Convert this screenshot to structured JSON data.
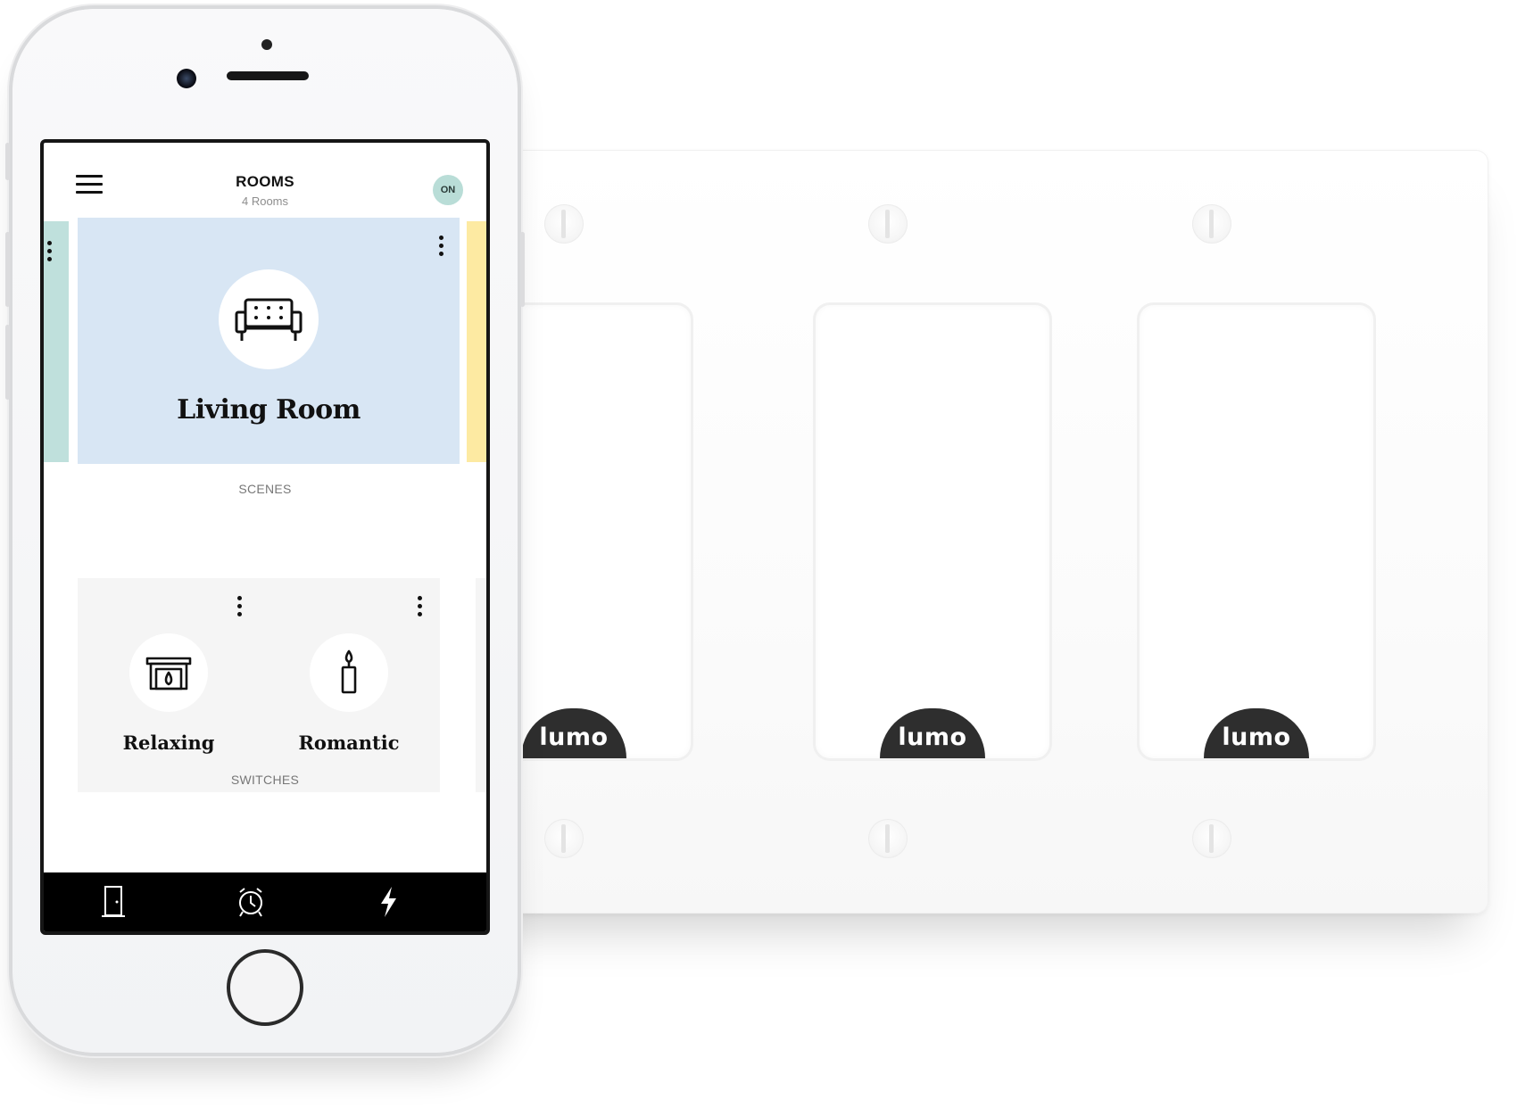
{
  "app": {
    "header": {
      "title": "ROOMS",
      "subtitle": "4 Rooms",
      "status_pill": "ON",
      "menu_icon": "hamburger-menu-icon"
    },
    "room": {
      "name": "Living Room",
      "icon": "sofa-icon",
      "color": "#d8e6f4",
      "adjacent_colors": [
        "#bfe0dc",
        "#fdeaa2"
      ]
    },
    "sections": {
      "scenes": "SCENES",
      "switches": "SWITCHES"
    },
    "scenes": [
      {
        "name": "Relaxing",
        "icon": "fireplace-icon"
      },
      {
        "name": "Romantic",
        "icon": "candle-icon"
      }
    ],
    "tabbar": {
      "items": [
        "door-icon",
        "alarm-clock-icon",
        "lightning-icon"
      ]
    }
  },
  "wall_plate": {
    "switches": [
      {
        "brand": "lumo"
      },
      {
        "brand": "lumo"
      },
      {
        "brand": "lumo"
      }
    ]
  },
  "colors": {
    "status_pill": "#b9ddd7",
    "badge": "#2e2e2e",
    "tabbar": "#000000"
  }
}
